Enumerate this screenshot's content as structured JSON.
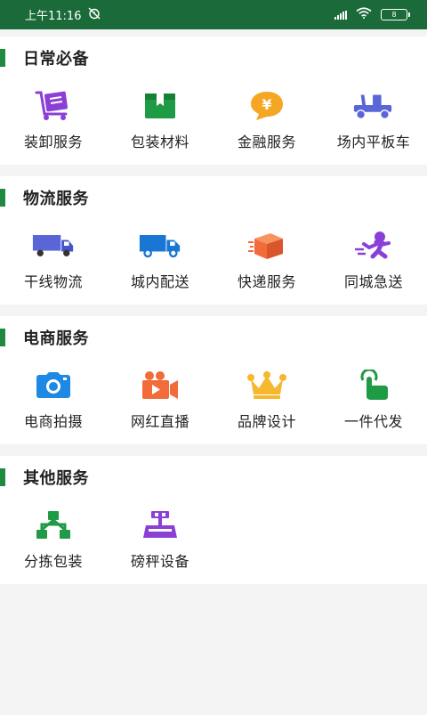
{
  "status_bar": {
    "time": "上午11:16",
    "battery": "8",
    "icons": [
      "alarm-off-icon",
      "signal-icon",
      "wifi-icon",
      "battery-icon"
    ]
  },
  "sections": [
    {
      "title": "日常必备",
      "items": [
        {
          "label": "装卸服务",
          "icon": "handcart-icon",
          "color": "#8b3fd6"
        },
        {
          "label": "包装材料",
          "icon": "box-icon",
          "color": "#1f9a45"
        },
        {
          "label": "金融服务",
          "icon": "yuan-bubble-icon",
          "color": "#f5a623"
        },
        {
          "label": "场内平板车",
          "icon": "flatbed-truck-icon",
          "color": "#5a66d8"
        }
      ]
    },
    {
      "title": "物流服务",
      "items": [
        {
          "label": "干线物流",
          "icon": "lorry-icon",
          "color": "#5a66d8"
        },
        {
          "label": "城内配送",
          "icon": "delivery-truck-icon",
          "color": "#1976d2"
        },
        {
          "label": "快递服务",
          "icon": "parcel-icon",
          "color": "#f26b3a"
        },
        {
          "label": "同城急送",
          "icon": "running-man-icon",
          "color": "#8b3fd6"
        }
      ]
    },
    {
      "title": "电商服务",
      "items": [
        {
          "label": "电商拍摄",
          "icon": "camera-icon",
          "color": "#1e88e5"
        },
        {
          "label": "网红直播",
          "icon": "video-camera-icon",
          "color": "#f26b3a"
        },
        {
          "label": "品牌设计",
          "icon": "crown-icon",
          "color": "#f5b82e"
        },
        {
          "label": "一件代发",
          "icon": "tap-hand-icon",
          "color": "#1f9a45"
        }
      ]
    },
    {
      "title": "其他服务",
      "items": [
        {
          "label": "分拣包装",
          "icon": "sort-tree-icon",
          "color": "#1f9a45"
        },
        {
          "label": "磅秤设备",
          "icon": "scale-icon",
          "color": "#8b3fd6"
        }
      ]
    }
  ]
}
